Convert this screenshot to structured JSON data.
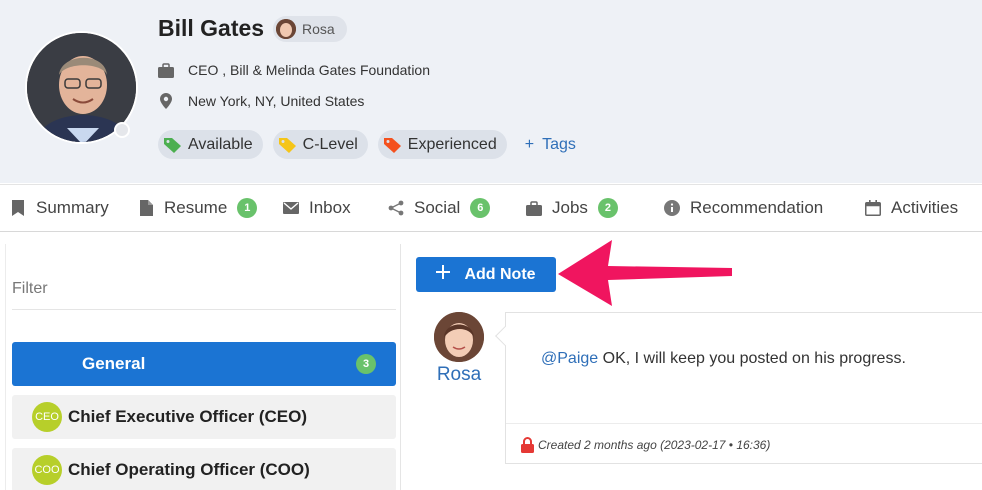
{
  "profile": {
    "name": "Bill Gates",
    "owner": "Rosa",
    "job": "CEO , Bill & Melinda Gates Foundation",
    "location": "New York, NY, United States",
    "tags": [
      {
        "label": "Available",
        "color": "#4caf50",
        "icon": "tag-icon"
      },
      {
        "label": "C-Level",
        "color": "#f5c518",
        "icon": "tag-icon"
      },
      {
        "label": "Experienced",
        "color": "#f4511e",
        "icon": "tag-icon"
      }
    ],
    "add_tags_label": "Tags"
  },
  "tabs": [
    {
      "label": "Summary",
      "icon": "bookmark-icon"
    },
    {
      "label": "Resume",
      "icon": "document-icon",
      "badge": "1"
    },
    {
      "label": "Inbox",
      "icon": "envelope-icon"
    },
    {
      "label": "Social",
      "icon": "share-icon",
      "badge": "6"
    },
    {
      "label": "Jobs",
      "icon": "briefcase-icon",
      "badge": "2"
    },
    {
      "label": "Recommendation",
      "icon": "info-icon"
    },
    {
      "label": "Activities",
      "icon": "calendar-icon"
    }
  ],
  "filter": {
    "placeholder": "Filter"
  },
  "categories": {
    "general": {
      "label": "General",
      "count": "3"
    },
    "items": [
      {
        "abbr": "CEO",
        "label": "Chief Executive Officer (CEO)"
      },
      {
        "abbr": "COO",
        "label": "Chief Operating Officer (COO)"
      }
    ]
  },
  "notes": {
    "add_label": "Add Note",
    "items": [
      {
        "author": "Rosa",
        "mention": "@Paige",
        "text": " OK, I will keep you posted on his progress.",
        "created": "Created 2 months ago (2023-02-17 • 16:36)"
      }
    ]
  },
  "colors": {
    "accent": "#1b74d3",
    "badge": "#69c26b",
    "arrow": "#f0155f",
    "link": "#2f6fb8"
  }
}
